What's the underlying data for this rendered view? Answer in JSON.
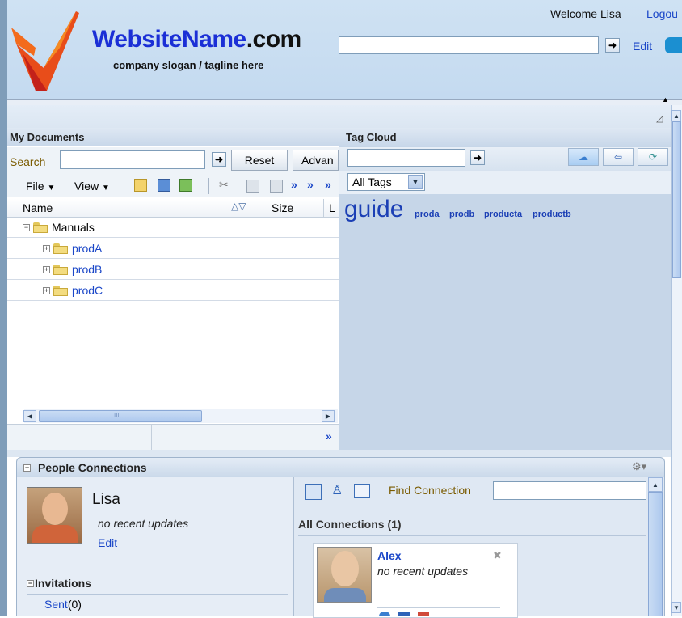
{
  "header": {
    "site_name": "WebsiteName",
    "site_tld": ".com",
    "slogan": "company slogan / tagline here",
    "welcome": "Welcome Lisa",
    "logout": "Logou",
    "search_value": "",
    "edit": "Edit"
  },
  "my_documents": {
    "title": "My Documents",
    "search_label": "Search",
    "search_value": "",
    "reset": "Reset",
    "advanced": "Advan",
    "file_menu": "File",
    "view_menu": "View",
    "col_name": "Name",
    "col_size": "Size",
    "col_l": "L",
    "tree": [
      {
        "label": "Manuals",
        "expander": "−"
      },
      {
        "label": "prodA",
        "expander": "+"
      },
      {
        "label": "prodB",
        "expander": "+"
      },
      {
        "label": "prodC",
        "expander": "+"
      }
    ],
    "scroll_grip": "III",
    "more": "»"
  },
  "tag_cloud": {
    "title": "Tag Cloud",
    "search_value": "",
    "filter": "All Tags",
    "tags": [
      "guide",
      "proda",
      "prodb",
      "producta",
      "productb"
    ]
  },
  "people": {
    "title": "People Connections",
    "user_name": "Lisa",
    "status": "no recent updates",
    "edit": "Edit",
    "invitations": "Invitations",
    "sent_label": "Sent",
    "sent_count": "(0)",
    "find_connection": "Find Connection",
    "all_connections": "All Connections (1)",
    "connection": {
      "name": "Alex",
      "status": "no recent updates"
    }
  },
  "colors": {
    "brand_blue": "#1b2fd6",
    "link_blue": "#1b47c8",
    "panel_bg": "#c6d6e8"
  }
}
